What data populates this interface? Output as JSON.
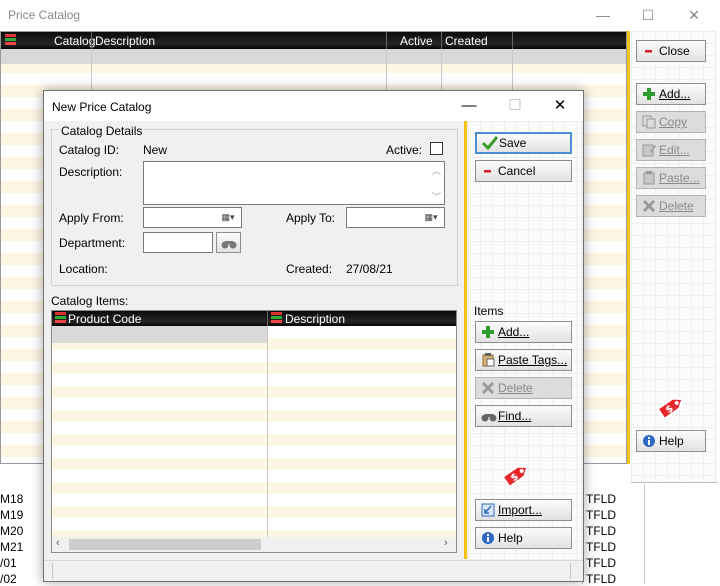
{
  "background_window": {
    "title": "Price Catalog",
    "controls": {
      "minimize": "—",
      "maximize": "☐",
      "close": "✕"
    },
    "grid": {
      "columns": [
        "Catalog",
        "Description",
        "Active",
        "Created"
      ]
    },
    "buttons": {
      "close": "Close",
      "add": "Add...",
      "copy": "Copy",
      "edit": "Edit...",
      "paste": "Paste...",
      "delete": "Delete",
      "help": "Help"
    },
    "bottom_rows": [
      {
        "code": "M18",
        "suffix": "TFLD"
      },
      {
        "code": "M19",
        "suffix": "TFLD"
      },
      {
        "code": "M20",
        "suffix": "TFLD"
      },
      {
        "code": "M21",
        "suffix": "TFLD"
      },
      {
        "code": "/01",
        "suffix": "TFLD"
      },
      {
        "code": "/02",
        "suffix": "TFLD"
      }
    ]
  },
  "dialog": {
    "title": "New Price Catalog",
    "controls": {
      "minimize": "—",
      "maximize": "☐",
      "close": "✕"
    },
    "details": {
      "group_label": "Catalog Details",
      "catalog_id_label": "Catalog ID:",
      "catalog_id_value": "New",
      "active_label": "Active:",
      "active_checked": false,
      "description_label": "Description:",
      "description_value": "",
      "apply_from_label": "Apply From:",
      "apply_from_value": "",
      "apply_to_label": "Apply To:",
      "apply_to_value": "",
      "department_label": "Department:",
      "department_value": "",
      "location_label": "Location:",
      "location_value": "",
      "created_label": "Created:",
      "created_value": "27/08/21"
    },
    "items": {
      "label": "Catalog Items:",
      "columns": [
        "Product Code",
        "Description"
      ],
      "rows": []
    },
    "buttons": {
      "save": "Save",
      "cancel": "Cancel",
      "items_label": "Items",
      "add": "Add...",
      "paste_tags": "Paste Tags...",
      "delete": "Delete",
      "find": "Find...",
      "import": "Import...",
      "help": "Help"
    }
  },
  "colors": {
    "accent_bar": "#f2c216",
    "header_bg": "#111111",
    "selection": "#d9d9d9",
    "tag": "#e8262b"
  }
}
